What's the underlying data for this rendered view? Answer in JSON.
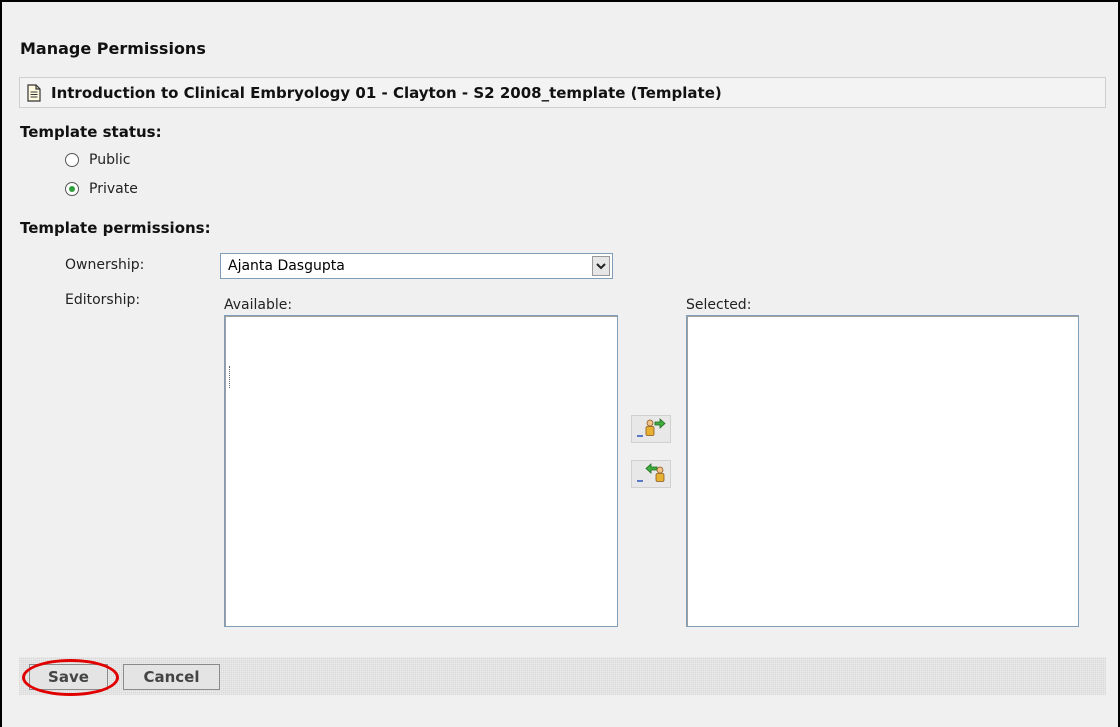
{
  "page": {
    "title": "Manage Permissions",
    "template_name": "Introduction to Clinical Embryology 01 - Clayton - S2 2008_template (Template)"
  },
  "status": {
    "heading": "Template status:",
    "options": [
      {
        "label": "Public",
        "checked": false
      },
      {
        "label": "Private",
        "checked": true
      }
    ]
  },
  "permissions": {
    "heading": "Template permissions:",
    "ownership_label": "Ownership:",
    "ownership_value": "Ajanta Dasgupta",
    "editorship_label": "Editorship:",
    "available_label": "Available:",
    "selected_label": "Selected:",
    "available_items": [],
    "selected_items": []
  },
  "actions": {
    "save_label": "Save",
    "cancel_label": "Cancel"
  },
  "icons": {
    "header": "document-icon",
    "add": "add-user-icon",
    "remove": "remove-user-icon",
    "dropdown": "chevron-down-icon"
  },
  "colors": {
    "radio_checked": "#2f9f3b",
    "highlight": "#e00000",
    "field_border": "#7f9db9"
  }
}
